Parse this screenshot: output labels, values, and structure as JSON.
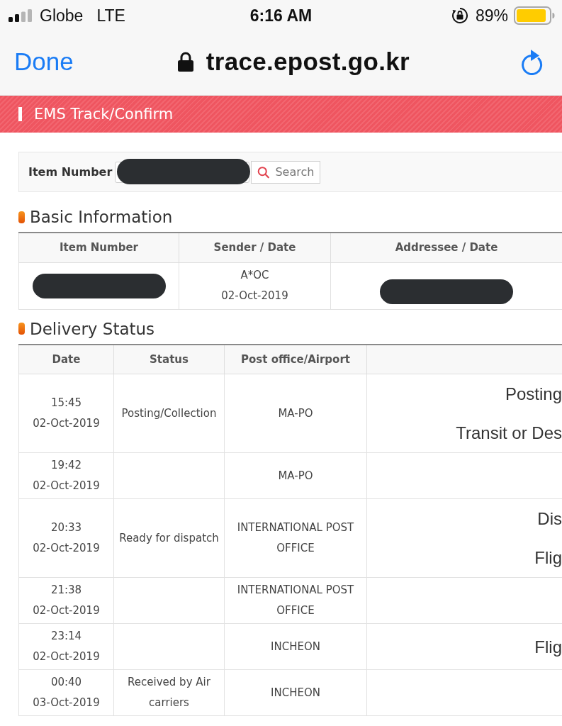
{
  "status_bar": {
    "carrier": "Globe",
    "network": "LTE",
    "time": "6:16 AM",
    "battery": "89%"
  },
  "browser_bar": {
    "done": "Done",
    "url": "trace.epost.go.kr"
  },
  "banner": {
    "title": "EMS Track/Confirm"
  },
  "search": {
    "label": "Item Number",
    "value_redacted": true,
    "button": "Search"
  },
  "basic_information": {
    "title": "Basic Information",
    "columns": [
      "Item Number",
      "Sender / Date",
      "Addressee / Date"
    ],
    "rows": [
      {
        "item_number_redacted": true,
        "sender": "A*OC",
        "sender_date": "02-Oct-2019",
        "addressee_redacted": true
      }
    ]
  },
  "delivery_status": {
    "title": "Delivery Status",
    "columns": [
      "Date",
      "Status",
      "Post office/Airport"
    ],
    "rows": [
      {
        "time": "15:45",
        "date": "02-Oct-2019",
        "status": "Posting/Collection",
        "office": "MA-PO",
        "column_4": [
          "Posting",
          "Transit or Des"
        ]
      },
      {
        "time": "19:42",
        "date": "02-Oct-2019",
        "office": "MA-PO"
      },
      {
        "time": "20:33",
        "date": "02-Oct-2019",
        "status": "Ready for dispatch",
        "office": "INTERNATIONAL POST OFFICE",
        "column_4": [
          "Dis",
          "Flig"
        ]
      },
      {
        "time": "21:38",
        "date": "02-Oct-2019",
        "office": "INTERNATIONAL POST OFFICE"
      },
      {
        "time": "23:14",
        "date": "02-Oct-2019",
        "office": "INCHEON",
        "column_4": [
          "Flig"
        ]
      },
      {
        "time": "00:40",
        "date": "03-Oct-2019",
        "status": "Received by Air carriers",
        "office": "INCHEON"
      }
    ]
  }
}
